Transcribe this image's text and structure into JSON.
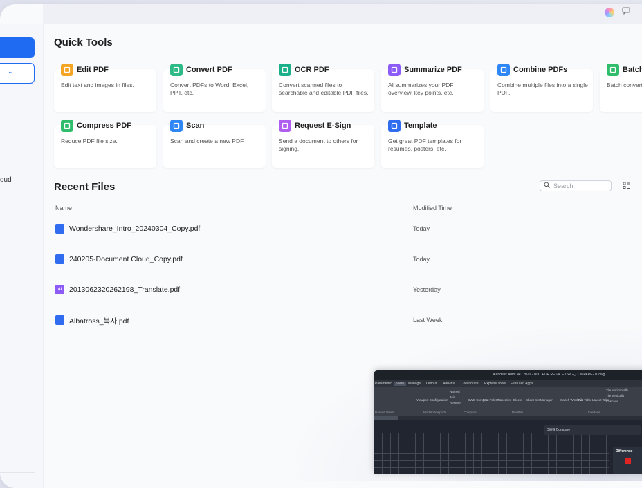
{
  "sidebar": {
    "cloud_text": "oud"
  },
  "quick_tools": {
    "title": "Quick Tools",
    "items": [
      {
        "label": "Edit PDF",
        "desc": "Edit text and images in files.",
        "color": "#f5a524",
        "icon": "edit-pdf-icon"
      },
      {
        "label": "Convert PDF",
        "desc": "Convert PDFs to Word, Excel, PPT, etc.",
        "color": "#2dba86",
        "icon": "convert-pdf-icon"
      },
      {
        "label": "OCR PDF",
        "desc": "Convert scanned files to searchable and editable PDF files.",
        "color": "#1bb08a",
        "icon": "ocr-pdf-icon"
      },
      {
        "label": "Summarize PDF",
        "desc": "AI summarizes your PDF overview, key points, etc.",
        "color": "#8d5cf6",
        "icon": "summarize-pdf-icon"
      },
      {
        "label": "Combine PDFs",
        "desc": "Combine multiple files into a single PDF.",
        "color": "#2f86f5",
        "icon": "combine-pdfs-icon"
      },
      {
        "label": "Batch",
        "desc": "Batch convert PDFs, etc.",
        "color": "#2fbd6b",
        "icon": "batch-icon"
      },
      {
        "label": "Compress PDF",
        "desc": "Reduce PDF file size.",
        "color": "#2fbd6b",
        "icon": "compress-pdf-icon"
      },
      {
        "label": "Scan",
        "desc": "Scan and create a new PDF.",
        "color": "#2f86f5",
        "icon": "scan-icon"
      },
      {
        "label": "Request E-Sign",
        "desc": "Send a document to others for signing.",
        "color": "#b05ef2",
        "icon": "esign-icon"
      },
      {
        "label": "Template",
        "desc": "Get great PDF templates for resumes, posters, etc.",
        "color": "#2f6cf0",
        "icon": "template-icon"
      }
    ]
  },
  "recent": {
    "title": "Recent Files",
    "search_placeholder": "Search",
    "col_name": "Name",
    "col_modified": "Modified Time",
    "files": [
      {
        "name": "Wondershare_Intro_20240304_Copy.pdf",
        "modified": "Today",
        "icon_color": "#2f6cf0",
        "icon_text": ""
      },
      {
        "name": "240205-Document Cloud_Copy.pdf",
        "modified": "Today",
        "icon_color": "#2f6cf0",
        "icon_text": ""
      },
      {
        "name": "2013062320262198_Translate.pdf",
        "modified": "Yesterday",
        "icon_color": "#8d5cf6",
        "icon_text": "AI"
      },
      {
        "name": "Albatross_복사.pdf",
        "modified": "Last Week",
        "icon_color": "#2f6cf0",
        "icon_text": ""
      }
    ]
  },
  "preview": {
    "title": "Autodesk AutoCAD 2020 - NOT FOR RESALE   DWG_COMPARE-01.dwg",
    "tabs": [
      "Parametric",
      "View",
      "Manage",
      "Output",
      "Add-ins",
      "Collaborate",
      "Express Tools",
      "Featured Apps"
    ],
    "groups": [
      "Named Views",
      "Model Viewports",
      "Compare",
      "Palettes",
      "Interface"
    ],
    "buttons": [
      "Viewport Configuration",
      "Named",
      "Join",
      "Restore",
      "DWG Compare",
      "Tool Palettes",
      "Properties",
      "Blocks",
      "Sheet Set Manager",
      "Switch Windows",
      "File Tabs",
      "Layout Tabs",
      "Tile Horizontally",
      "Tile Vertically",
      "Cascade"
    ],
    "compare_label": "DWG Compare",
    "diff_label": "Difference"
  }
}
